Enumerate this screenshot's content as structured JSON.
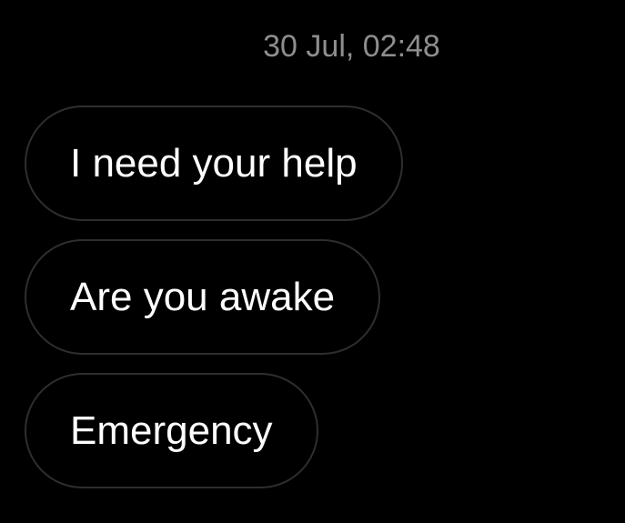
{
  "conversation": {
    "timestamp": "30 Jul, 02:48",
    "messages": [
      {
        "text": "I need your help"
      },
      {
        "text": "Are you awake"
      },
      {
        "text": "Emergency"
      }
    ]
  },
  "colors": {
    "background": "#000000",
    "bubble_border": "#2e2e2e",
    "message_text": "#ffffff",
    "timestamp_text": "#8e8e8e"
  }
}
